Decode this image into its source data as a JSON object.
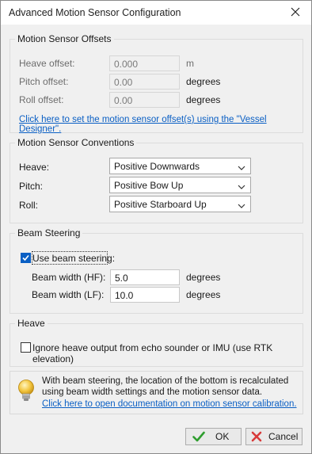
{
  "window": {
    "title": "Advanced Motion Sensor Configuration",
    "close_icon": "close-icon"
  },
  "offsets": {
    "legend": "Motion Sensor Offsets",
    "heave": {
      "label": "Heave offset:",
      "value": "0.000",
      "unit": "m"
    },
    "pitch": {
      "label": "Pitch offset:",
      "value": "0.00",
      "unit": "degrees"
    },
    "roll": {
      "label": "Roll offset:",
      "value": "0.00",
      "unit": "degrees"
    },
    "link": "Click here to set the motion sensor offset(s) using the \"Vessel Designer\"."
  },
  "conventions": {
    "legend": "Motion Sensor Conventions",
    "heave": {
      "label": "Heave:",
      "value": "Positive Downwards"
    },
    "pitch": {
      "label": "Pitch:",
      "value": "Positive Bow Up"
    },
    "roll": {
      "label": "Roll:",
      "value": "Positive Starboard Up"
    }
  },
  "beam": {
    "legend": "Beam Steering",
    "use_label": "Use beam steering:",
    "use_checked": true,
    "hf": {
      "label": "Beam width (HF):",
      "value": "5.0",
      "unit": "degrees"
    },
    "lf": {
      "label": "Beam width (LF):",
      "value": "10.0",
      "unit": "degrees"
    }
  },
  "heave": {
    "legend": "Heave",
    "ignore_label": "Ignore heave output from echo sounder or IMU (use RTK elevation)",
    "ignore_checked": false
  },
  "info": {
    "icon": "lightbulb-icon",
    "line1": "With beam steering, the location of the bottom is recalculated",
    "line2": "using beam width settings and the motion sensor data.",
    "link": "Click here to open documentation on motion sensor calibration."
  },
  "buttons": {
    "ok": "OK",
    "cancel": "Cancel"
  },
  "colors": {
    "link": "#0a5fc4",
    "ok_check": "#2e9d2e",
    "cancel_x": "#d83a3a",
    "bulb": "#f3c640"
  }
}
